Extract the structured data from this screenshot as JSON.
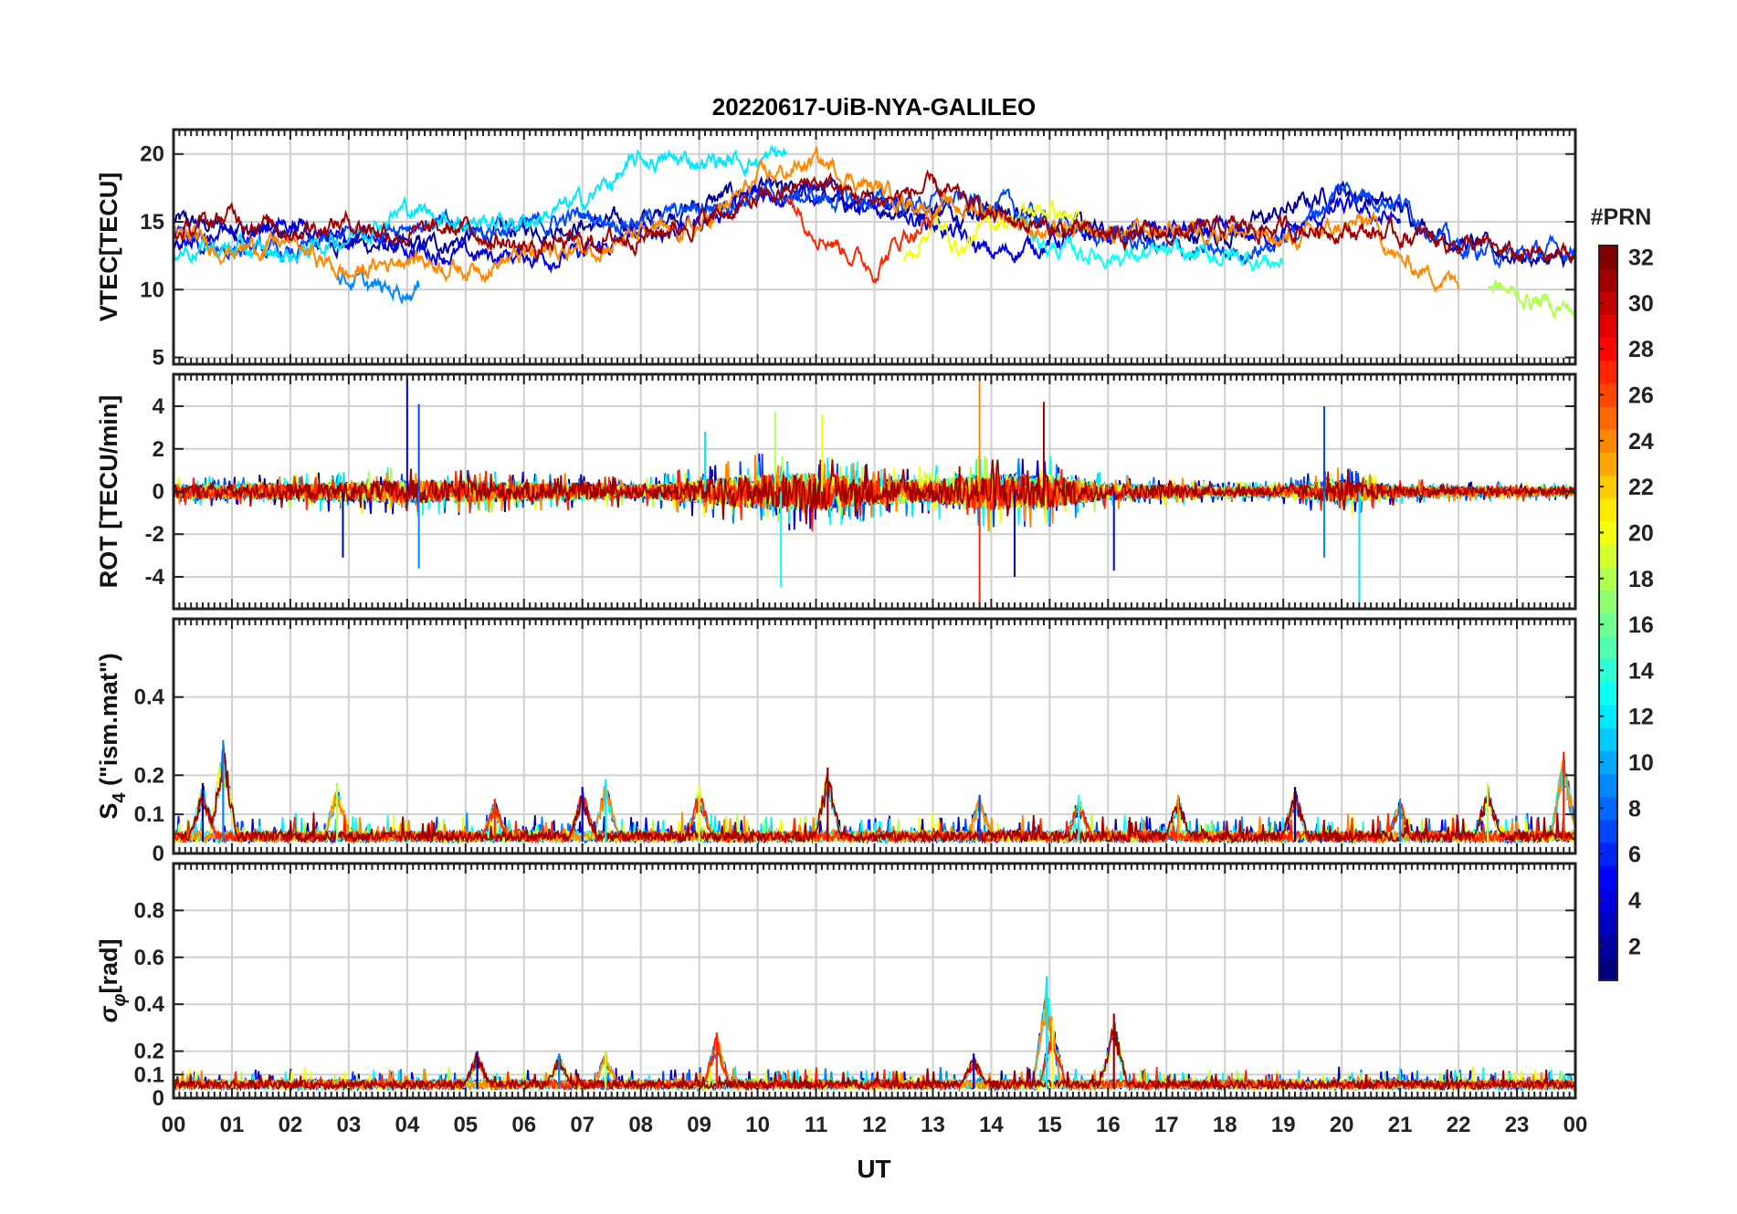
{
  "title": "20220617-UiB-NYA-GALILEO",
  "xlabel": "UT",
  "colorbar": {
    "label": "#PRN",
    "min": 1,
    "max": 32,
    "ticks": [
      "2",
      "4",
      "6",
      "8",
      "10",
      "12",
      "14",
      "16",
      "18",
      "20",
      "22",
      "24",
      "26",
      "28",
      "30",
      "32"
    ]
  },
  "chart_data": [
    {
      "type": "line",
      "panel": "VTEC",
      "ylabel": "VTEC[TECU]",
      "xlim": [
        0,
        24
      ],
      "ylim": [
        4.5,
        21.8
      ],
      "yticks": [
        5,
        10,
        15,
        20
      ],
      "xticklabels": [
        "00",
        "01",
        "02",
        "03",
        "04",
        "05",
        "06",
        "07",
        "08",
        "09",
        "10",
        "11",
        "12",
        "13",
        "14",
        "15",
        "16",
        "17",
        "18",
        "19",
        "20",
        "21",
        "22",
        "23",
        "00"
      ],
      "grid": true,
      "colorby": "PRN",
      "series": [
        {
          "prn": 2,
          "x": [
            0,
            2,
            4,
            6,
            8,
            10,
            12,
            14,
            16,
            18,
            20,
            21,
            22,
            23,
            24
          ],
          "y": [
            15,
            14,
            13,
            14.5,
            15,
            17.5,
            16,
            16,
            14,
            14,
            17.5,
            16,
            13.5,
            12.5,
            12
          ]
        },
        {
          "prn": 4,
          "x": [
            0,
            1,
            2,
            3,
            4,
            5,
            6,
            7,
            8,
            9,
            10,
            11,
            12,
            13,
            14,
            15,
            16,
            17,
            18,
            19,
            20,
            21
          ],
          "y": [
            13,
            14,
            15,
            14,
            13,
            12.5,
            12.5,
            12.5,
            14,
            15,
            17,
            17.5,
            16,
            15,
            12.5,
            13.5,
            14,
            14.5,
            14,
            14,
            16,
            15
          ]
        },
        {
          "prn": 7,
          "x": [
            0,
            1,
            2,
            3,
            4,
            5,
            6,
            7,
            8,
            9,
            10,
            12,
            14,
            15,
            16,
            17,
            18,
            19,
            20,
            21,
            22,
            23,
            24
          ],
          "y": [
            14,
            13,
            12.5,
            14,
            15,
            14.5,
            14.5,
            15.5,
            15,
            16,
            17,
            16.5,
            16.5,
            15,
            14,
            13,
            12.5,
            13.5,
            17.5,
            16.5,
            13,
            12.5,
            13
          ]
        },
        {
          "prn": 9,
          "x": [
            2.8,
            3.5,
            4.2
          ],
          "y": [
            11,
            10,
            10
          ]
        },
        {
          "prn": 12,
          "x": [
            0,
            1,
            2,
            3,
            4,
            5,
            6,
            7,
            7.5,
            8,
            9,
            10,
            10.5
          ],
          "y": [
            13,
            13,
            12.5,
            14,
            16,
            15,
            15,
            16.5,
            18,
            19.5,
            19.5,
            19.5,
            20
          ]
        },
        {
          "prn": 13,
          "x": [
            14.5,
            15,
            16,
            17,
            18,
            19
          ],
          "y": [
            15,
            13,
            12.5,
            12.5,
            12.5,
            12
          ]
        },
        {
          "prn": 18,
          "x": [
            22.5,
            23,
            24
          ],
          "y": [
            10.5,
            9.5,
            8.5
          ]
        },
        {
          "prn": 20,
          "x": [
            12.5,
            13,
            13.5,
            14,
            14.5,
            15,
            15.5
          ],
          "y": [
            12,
            15,
            13,
            15,
            15.5,
            16,
            15
          ]
        },
        {
          "prn": 24,
          "x": [
            0,
            1,
            2,
            3,
            4,
            5,
            6,
            7,
            8,
            9,
            10,
            11,
            12,
            13,
            14,
            15,
            16,
            17,
            18,
            19,
            20,
            20.5,
            21,
            22
          ],
          "y": [
            14,
            13,
            13.5,
            11,
            12.5,
            11.5,
            12.5,
            13,
            14,
            14.5,
            18,
            19.5,
            17.5,
            16,
            16,
            14,
            14,
            14.5,
            14.5,
            13.5,
            14.5,
            15,
            12,
            10.5
          ]
        },
        {
          "prn": 27,
          "x": [
            10.5,
            11,
            11.5,
            12,
            12.5,
            13
          ],
          "y": [
            17,
            14.5,
            13,
            11.5,
            14,
            15
          ]
        },
        {
          "prn": 31,
          "x": [
            0,
            1,
            2,
            3,
            4,
            5,
            6,
            7,
            8,
            9,
            10,
            11,
            12,
            13,
            14,
            15,
            16,
            17,
            18,
            19,
            20,
            21,
            22,
            23,
            24
          ],
          "y": [
            14,
            15.5,
            14.5,
            15,
            14,
            14.5,
            13,
            13.5,
            14,
            15,
            16.5,
            18,
            16.5,
            17.5,
            15.5,
            14.5,
            14,
            14,
            14.5,
            14.5,
            14.5,
            14,
            13.5,
            12.5,
            12.5
          ]
        }
      ]
    },
    {
      "type": "line",
      "panel": "ROT",
      "ylabel": "ROT [TECU/min]",
      "xlim": [
        0,
        24
      ],
      "ylim": [
        -5.5,
        5.5
      ],
      "yticks": [
        -4,
        -2,
        0,
        2,
        4
      ],
      "grid": true,
      "baseline": 0,
      "colorby": "PRN",
      "noise_profile": {
        "x": [
          0,
          2,
          4,
          6,
          8,
          9,
          10,
          11,
          12,
          13,
          14,
          15,
          16,
          17,
          18,
          19,
          20,
          21,
          22,
          23,
          24
        ],
        "amplitude": [
          0.6,
          0.7,
          1.0,
          0.8,
          0.6,
          1.0,
          1.5,
          1.6,
          1.1,
          1.0,
          1.6,
          1.4,
          0.7,
          0.6,
          0.4,
          0.5,
          1.0,
          0.5,
          0.4,
          0.4,
          0.3
        ]
      },
      "spikes": [
        {
          "x": 2.9,
          "y": -3.1
        },
        {
          "x": 4.0,
          "y": 5.3
        },
        {
          "x": 4.2,
          "y": 4.1
        },
        {
          "x": 4.2,
          "y": -3.6
        },
        {
          "x": 9.1,
          "y": 2.8
        },
        {
          "x": 10.4,
          "y": -4.5
        },
        {
          "x": 10.3,
          "y": 3.7
        },
        {
          "x": 11.1,
          "y": 3.6
        },
        {
          "x": 13.8,
          "y": 5.3
        },
        {
          "x": 13.8,
          "y": -5.3
        },
        {
          "x": 14.9,
          "y": 4.2
        },
        {
          "x": 14.4,
          "y": -4.0
        },
        {
          "x": 16.1,
          "y": -3.7
        },
        {
          "x": 19.7,
          "y": 4.0
        },
        {
          "x": 19.7,
          "y": -3.1
        },
        {
          "x": 20.3,
          "y": -5.3
        }
      ]
    },
    {
      "type": "line",
      "panel": "S4",
      "ylabel": "S4 (\"ism.mat\")",
      "ylabel_main": "S",
      "ylabel_sub": "4",
      "ylabel_rest": " (\"ism.mat\")",
      "xlim": [
        0,
        24
      ],
      "ylim": [
        0,
        0.6
      ],
      "yticks": [
        0,
        0.1,
        0.2,
        0.4
      ],
      "yticklabels": [
        "0",
        "0.1",
        "0.2",
        "0.4"
      ],
      "grid": true,
      "baseline": 0.03,
      "colorby": "PRN",
      "peaks": [
        {
          "x": 0.5,
          "y": 0.18
        },
        {
          "x": 0.85,
          "y": 0.29
        },
        {
          "x": 2.8,
          "y": 0.18
        },
        {
          "x": 5.5,
          "y": 0.14
        },
        {
          "x": 7.0,
          "y": 0.17
        },
        {
          "x": 7.4,
          "y": 0.19
        },
        {
          "x": 9.0,
          "y": 0.17
        },
        {
          "x": 11.2,
          "y": 0.22
        },
        {
          "x": 13.8,
          "y": 0.15
        },
        {
          "x": 15.5,
          "y": 0.15
        },
        {
          "x": 17.2,
          "y": 0.15
        },
        {
          "x": 19.2,
          "y": 0.17
        },
        {
          "x": 21.0,
          "y": 0.14
        },
        {
          "x": 22.5,
          "y": 0.18
        },
        {
          "x": 23.8,
          "y": 0.26
        }
      ]
    },
    {
      "type": "line",
      "panel": "sigma_phi",
      "ylabel": "σφ[rad]",
      "ylabel_main": "σ",
      "ylabel_sub": "φ",
      "ylabel_rest": "[rad]",
      "xlim": [
        0,
        24
      ],
      "ylim": [
        0,
        1
      ],
      "yticks": [
        0,
        0.1,
        0.2,
        0.4,
        0.6,
        0.8
      ],
      "yticklabels": [
        "0",
        "0.1",
        "0.2",
        "0.4",
        "0.6",
        "0.8"
      ],
      "grid": true,
      "baseline": 0.04,
      "colorby": "PRN",
      "peaks": [
        {
          "x": 5.2,
          "y": 0.2
        },
        {
          "x": 6.6,
          "y": 0.19
        },
        {
          "x": 7.4,
          "y": 0.2
        },
        {
          "x": 9.3,
          "y": 0.28
        },
        {
          "x": 13.7,
          "y": 0.19
        },
        {
          "x": 14.95,
          "y": 0.52
        },
        {
          "x": 15.05,
          "y": 0.33
        },
        {
          "x": 16.1,
          "y": 0.36
        }
      ]
    }
  ]
}
